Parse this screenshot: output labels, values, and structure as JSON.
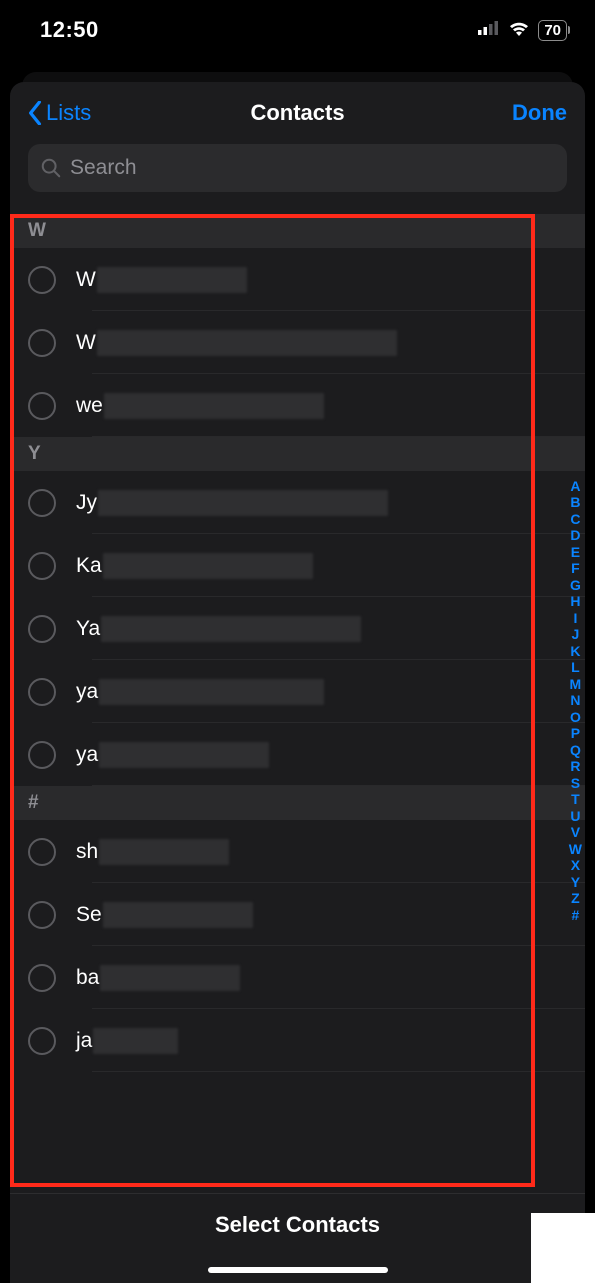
{
  "status": {
    "time": "12:50",
    "battery": "70"
  },
  "nav": {
    "back": "Lists",
    "title": "Contacts",
    "done": "Done"
  },
  "search": {
    "placeholder": "Search"
  },
  "sections": [
    {
      "letter": "W",
      "rows": [
        {
          "visible": "W",
          "blurWidth": 150
        },
        {
          "visible": "W",
          "blurWidth": 300
        },
        {
          "visible": "we",
          "blurWidth": 220
        }
      ]
    },
    {
      "letter": "Y",
      "rows": [
        {
          "visible": "Jy",
          "blurWidth": 290
        },
        {
          "visible": "Ka",
          "blurWidth": 210
        },
        {
          "visible": "Ya",
          "blurWidth": 260
        },
        {
          "visible": "ya",
          "blurWidth": 225
        },
        {
          "visible": "ya",
          "blurWidth": 170
        }
      ]
    },
    {
      "letter": "#",
      "rows": [
        {
          "visible": "sh",
          "blurWidth": 130
        },
        {
          "visible": "Se",
          "blurWidth": 150
        },
        {
          "visible": "ba",
          "blurWidth": 140
        },
        {
          "visible": "ja",
          "blurWidth": 85
        }
      ]
    }
  ],
  "alpha": [
    "A",
    "B",
    "C",
    "D",
    "E",
    "F",
    "G",
    "H",
    "I",
    "J",
    "K",
    "L",
    "M",
    "N",
    "O",
    "P",
    "Q",
    "R",
    "S",
    "T",
    "U",
    "V",
    "W",
    "X",
    "Y",
    "Z",
    "#"
  ],
  "footer": {
    "label": "Select Contacts"
  }
}
